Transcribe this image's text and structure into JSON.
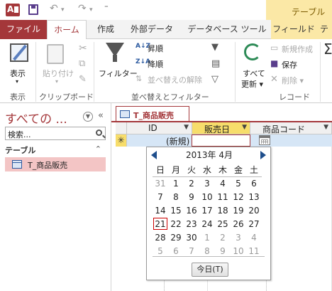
{
  "titlebar": {
    "contextual_group": "テーブル ツー"
  },
  "tabs": {
    "file": "ファイル",
    "home": "ホーム",
    "create": "作成",
    "external": "外部データ",
    "dbtools": "データベース ツール",
    "fields": "フィールド",
    "table": "テ"
  },
  "ribbon": {
    "view_label": "表示",
    "paste_label": "貼り付け",
    "filter_label": "フィルター",
    "asc_label": "昇順",
    "desc_label": "降順",
    "remove_sort_label": "並べ替えの解除",
    "refresh_label": "すべて",
    "refresh_label2": "更新",
    "new_label": "新規作成",
    "save_label": "保存",
    "delete_label": "削除",
    "groups": {
      "views": "表示",
      "clipboard": "クリップボード",
      "sort_filter": "並べ替えとフィルター",
      "records": "レコード"
    }
  },
  "nav": {
    "title": "すべての ...",
    "search_placeholder": "検索...",
    "group_label": "テーブル",
    "items": [
      {
        "label": "T_商品販売"
      }
    ]
  },
  "document": {
    "tab_label": "T_商品販売",
    "columns": [
      {
        "label": "ID"
      },
      {
        "label": "販売日"
      },
      {
        "label": "商品コード"
      }
    ],
    "new_row_marker": "✳",
    "new_row_label": "(新規)"
  },
  "calendar": {
    "month_label": "2013年 4月",
    "weekdays": [
      "日",
      "月",
      "火",
      "水",
      "木",
      "金",
      "土"
    ],
    "weeks": [
      [
        "31",
        "1",
        "2",
        "3",
        "4",
        "5",
        "6"
      ],
      [
        "7",
        "8",
        "9",
        "10",
        "11",
        "12",
        "13"
      ],
      [
        "14",
        "15",
        "16",
        "17",
        "18",
        "19",
        "20"
      ],
      [
        "21",
        "22",
        "23",
        "24",
        "25",
        "26",
        "27"
      ],
      [
        "28",
        "29",
        "30",
        "1",
        "2",
        "3",
        "4"
      ],
      [
        "5",
        "6",
        "7",
        "8",
        "9",
        "10",
        "11"
      ]
    ],
    "today_button": "今日(T)"
  }
}
